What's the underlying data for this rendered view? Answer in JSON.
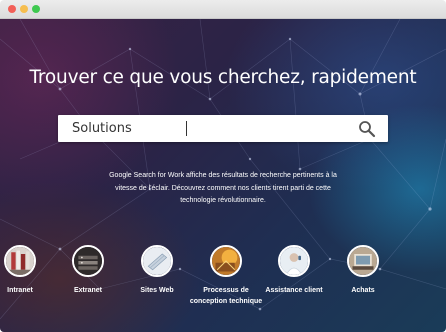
{
  "window": {
    "controls": [
      "close",
      "minimize",
      "maximize"
    ]
  },
  "hero": {
    "headline": "Trouver ce que vous cherchez, rapidement",
    "search": {
      "value": "Solutions",
      "icon": "search-icon"
    },
    "description": "Google Search for Work affiche des résultats de recherche pertinents à la vitesse de l'éclair. Découvrez comment nos clients tirent parti de cette technologie révolutionnaire."
  },
  "categories": [
    {
      "label": "Intranet",
      "icon": "intranet-icon"
    },
    {
      "label": "Extranet",
      "icon": "extranet-icon"
    },
    {
      "label": "Sites Web",
      "icon": "websites-icon"
    },
    {
      "label": "Processus de conception technique",
      "icon": "engineering-design-icon"
    },
    {
      "label": "Assistance client",
      "icon": "customer-support-icon"
    },
    {
      "label": "Achats",
      "icon": "shopping-icon"
    }
  ],
  "colors": {
    "background_dark": "#2b2346",
    "accent_teal": "#1a3c58",
    "text": "#ffffff"
  }
}
